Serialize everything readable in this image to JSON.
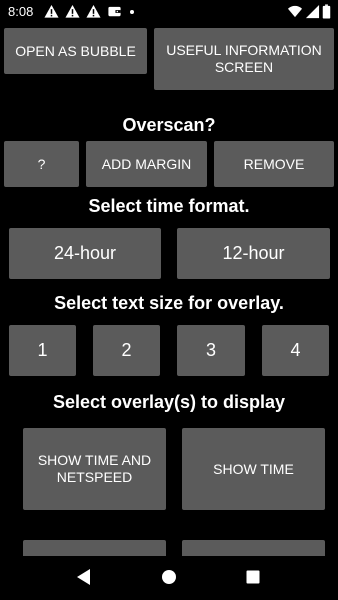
{
  "status_bar": {
    "time": "8:08",
    "icons": [
      "warning-icon",
      "warning-icon",
      "warning-icon",
      "wallet-icon",
      "dot-icon",
      "wifi-icon",
      "signal-icon",
      "battery-icon"
    ]
  },
  "top_buttons": {
    "open_bubble": "OPEN AS BUBBLE",
    "useful_info": "USEFUL INFORMATION SCREEN"
  },
  "overscan": {
    "heading": "Overscan?",
    "help": "?",
    "add_margin": "ADD MARGIN",
    "remove": "REMOVE"
  },
  "time_format": {
    "heading": "Select time format.",
    "option_24": "24-hour",
    "option_12": "12-hour"
  },
  "text_size": {
    "heading": "Select text size for overlay.",
    "options": [
      "1",
      "2",
      "3",
      "4"
    ]
  },
  "overlay_display": {
    "heading": "Select overlay(s) to display",
    "time_and_netspeed": "SHOW TIME AND NETSPEED",
    "time": "SHOW TIME"
  },
  "colors": {
    "background": "#000000",
    "button": "#5b5b5b",
    "text": "#ffffff"
  }
}
